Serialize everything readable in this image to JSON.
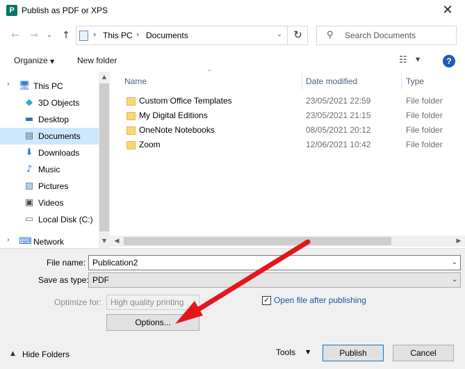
{
  "window": {
    "title": "Publish as PDF or XPS",
    "close_glyph": "✕",
    "app_icon_letter": "P"
  },
  "address": {
    "segments": [
      "This PC",
      "Documents"
    ],
    "separator": "›",
    "search_placeholder": "Search Documents"
  },
  "nav_buttons": {
    "back": "←",
    "forward": "→",
    "dropdown": "⌄",
    "up": "↑",
    "refresh": "↻"
  },
  "toolbar": {
    "organize": "Organize",
    "organize_caret": "▼",
    "new_folder": "New folder",
    "help": "?",
    "view_caret": "▼"
  },
  "sidebar": {
    "items": [
      {
        "label": "This PC",
        "icon": "computer-icon",
        "selected": false
      },
      {
        "label": "3D Objects",
        "icon": "cube-icon",
        "selected": false
      },
      {
        "label": "Desktop",
        "icon": "desktop-icon",
        "selected": false
      },
      {
        "label": "Documents",
        "icon": "document-icon",
        "selected": true
      },
      {
        "label": "Downloads",
        "icon": "download-icon",
        "selected": false
      },
      {
        "label": "Music",
        "icon": "music-icon",
        "selected": false
      },
      {
        "label": "Pictures",
        "icon": "picture-icon",
        "selected": false
      },
      {
        "label": "Videos",
        "icon": "video-icon",
        "selected": false
      },
      {
        "label": "Local Disk (C:)",
        "icon": "disk-icon",
        "selected": false
      },
      {
        "label": "Network",
        "icon": "network-icon",
        "selected": false
      }
    ]
  },
  "filelist": {
    "columns": [
      "Name",
      "Date modified",
      "Type"
    ],
    "rows": [
      {
        "name": "Custom Office Templates",
        "date": "23/05/2021 22:59",
        "type": "File folder"
      },
      {
        "name": "My Digital Editions",
        "date": "23/05/2021 21:15",
        "type": "File folder"
      },
      {
        "name": "OneNote Notebooks",
        "date": "08/05/2021 20:12",
        "type": "File folder"
      },
      {
        "name": "Zoom",
        "date": "12/06/2021 10:42",
        "type": "File folder"
      }
    ]
  },
  "form": {
    "file_name_label": "File name:",
    "file_name_value": "Publication2",
    "save_type_label": "Save as type:",
    "save_type_value": "PDF",
    "optimize_label": "Optimize for:",
    "optimize_value": "High quality printing",
    "open_after_label": "Open file after publishing",
    "open_after_checked": true,
    "options_button": "Options..."
  },
  "footer": {
    "hide_folders": "Hide Folders",
    "tools": "Tools",
    "publish": "Publish",
    "cancel": "Cancel"
  },
  "colors": {
    "accent": "#0078d7",
    "selected": "#cce8ff",
    "annotation_arrow": "#e5161b"
  }
}
